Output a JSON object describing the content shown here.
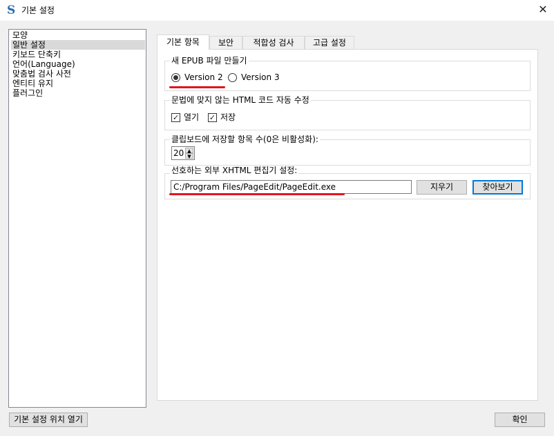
{
  "window": {
    "title": "기본 설정",
    "close_label": "✕",
    "app_icon_glyph": "S"
  },
  "sidebar": {
    "items": [
      {
        "label": "모양"
      },
      {
        "label": "일반 설정",
        "selected": true
      },
      {
        "label": "키보드 단축키"
      },
      {
        "label": "언어(Language)"
      },
      {
        "label": "맞춤법 검사 사전"
      },
      {
        "label": "엔티티 유지"
      },
      {
        "label": "플러그인"
      }
    ]
  },
  "tabs": [
    {
      "label": "기본 항목",
      "active": true
    },
    {
      "label": "보안"
    },
    {
      "label": "적합성 검사"
    },
    {
      "label": "고급 설정"
    }
  ],
  "groups": {
    "epub": {
      "legend": "새 EPUB 파일 만들기",
      "options": [
        {
          "label": "Version 2",
          "checked": true
        },
        {
          "label": "Version 3",
          "checked": false
        }
      ]
    },
    "fix_html": {
      "legend": "문법에 맞지 않는 HTML 코드 자동 수정",
      "options": [
        {
          "label": "열기",
          "checked": true,
          "mark": "✓"
        },
        {
          "label": "저장",
          "checked": true,
          "mark": "✓"
        }
      ]
    },
    "clipboard": {
      "legend": "클립보드에 저장할 항목 수(0은 비활성화):",
      "value": "20",
      "up_arrow": "▲",
      "down_arrow": "▼"
    },
    "editor": {
      "legend": "선호하는 외부 XHTML 편집기 설정:",
      "path": "C:/Program Files/PageEdit/PageEdit.exe",
      "clear_label": "지우기",
      "browse_label": "찾아보기"
    }
  },
  "footer": {
    "open_location_label": "기본 설정 위치 열기",
    "ok_label": "확인"
  },
  "colors": {
    "highlight_underline": "#e0141e",
    "default_button_border": "#0078d7"
  }
}
